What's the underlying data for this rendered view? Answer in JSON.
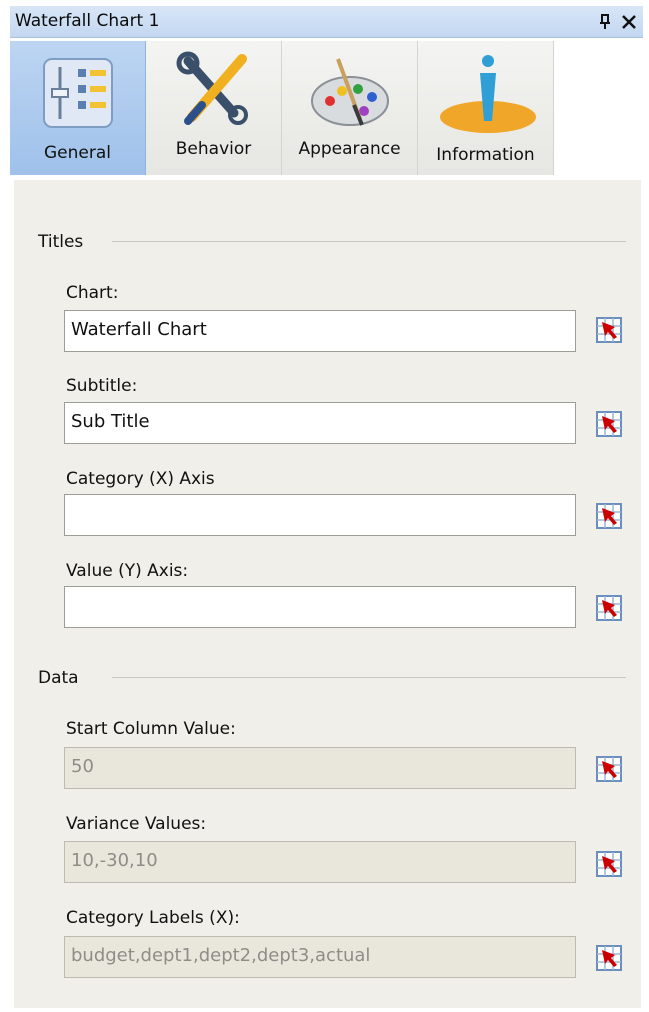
{
  "window": {
    "title": "Waterfall Chart 1"
  },
  "tabs": [
    {
      "label": "General",
      "icon": "settings-sliders-icon",
      "active": true
    },
    {
      "label": "Behavior",
      "icon": "tools-icon",
      "active": false
    },
    {
      "label": "Appearance",
      "icon": "palette-icon",
      "active": false
    },
    {
      "label": "Information",
      "icon": "info-person-icon",
      "active": false
    }
  ],
  "sections": {
    "titles": {
      "label": "Titles",
      "fields": [
        {
          "label": "Chart:",
          "value": "Waterfall Chart"
        },
        {
          "label": "Subtitle:",
          "value": "Sub Title"
        },
        {
          "label": "Category (X) Axis",
          "value": ""
        },
        {
          "label": "Value (Y) Axis:",
          "value": ""
        }
      ]
    },
    "data": {
      "label": "Data",
      "fields": [
        {
          "label": "Start Column Value:",
          "value": "50"
        },
        {
          "label": "Variance Values:",
          "value": "10,-30,10"
        },
        {
          "label": "Category Labels (X):",
          "value": "budget,dept1,dept2,dept3,actual"
        }
      ]
    }
  },
  "colors": {
    "active_tab": "#b0ccef",
    "panel_bg": "#f0efe9",
    "disabled_field": "#e9e7dc",
    "cell_picker_arrow": "#cc0000"
  }
}
